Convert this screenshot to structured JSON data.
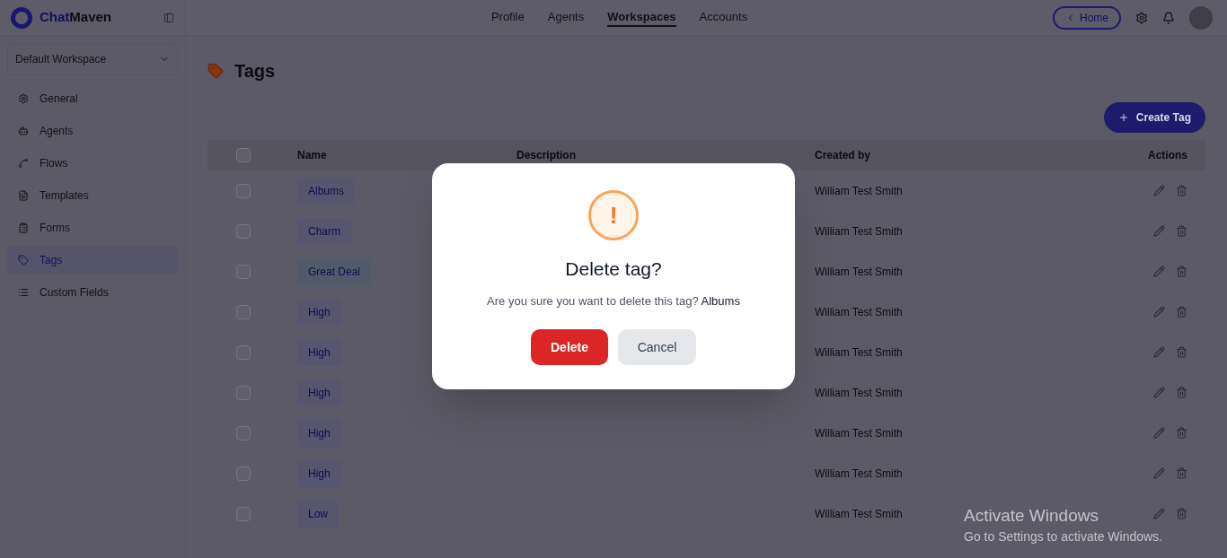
{
  "brand": {
    "first": "Chat",
    "second": "Maven"
  },
  "workspace": "Default Workspace",
  "nav": [
    {
      "label": "Profile",
      "selected": false
    },
    {
      "label": "Agents",
      "selected": false
    },
    {
      "label": "Workspaces",
      "selected": true
    },
    {
      "label": "Accounts",
      "selected": false
    }
  ],
  "home_button": "Home",
  "sidebar": {
    "items": [
      {
        "label": "General",
        "selected": false
      },
      {
        "label": "Agents",
        "selected": false
      },
      {
        "label": "Flows",
        "selected": false
      },
      {
        "label": "Templates",
        "selected": false
      },
      {
        "label": "Forms",
        "selected": false
      },
      {
        "label": "Tags",
        "selected": true
      },
      {
        "label": "Custom Fields",
        "selected": false
      }
    ]
  },
  "page_title": "Tags",
  "create_button": "Create Tag",
  "table": {
    "columns": [
      "Name",
      "Description",
      "Created by",
      "Actions"
    ],
    "select_all_checked": false,
    "rows": [
      {
        "name": "Albums",
        "color": "#56566e",
        "checked": false,
        "created_by": "William Test Smith"
      },
      {
        "name": "Charm",
        "color": "#56566e",
        "checked": false,
        "created_by": "William Test Smith"
      },
      {
        "name": "Great Deal",
        "color": "#525a6a",
        "checked": false,
        "created_by": "William Test Smith"
      },
      {
        "name": "High",
        "color": "#56566e",
        "checked": false,
        "created_by": "William Test Smith"
      },
      {
        "name": "High",
        "color": "#56566e",
        "checked": false,
        "created_by": "William Test Smith"
      },
      {
        "name": "High",
        "color": "#56566e",
        "checked": false,
        "created_by": "William Test Smith"
      },
      {
        "name": "High",
        "color": "#56566e",
        "checked": false,
        "created_by": "William Test Smith"
      },
      {
        "name": "High",
        "color": "#56566e",
        "checked": false,
        "created_by": "William Test Smith"
      },
      {
        "name": "Low",
        "color": "#56566e",
        "checked": false,
        "created_by": "William Test Smith"
      }
    ]
  },
  "dialog": {
    "icon": "!",
    "title": "Delete tag?",
    "message": "Are you sure you want to delete this tag?",
    "tag": "Albums",
    "confirm": "Delete",
    "cancel": "Cancel"
  },
  "os_notice": {
    "title": "Activate Windows",
    "subtitle": "Go to Settings to activate Windows."
  }
}
